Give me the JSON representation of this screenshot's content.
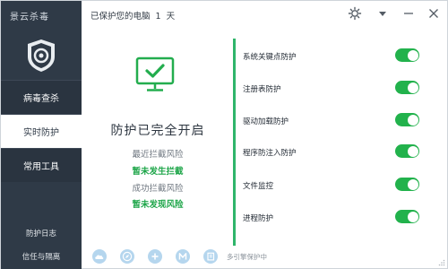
{
  "app": {
    "title": "景云杀毒"
  },
  "header": {
    "protected_text": "已保护您的电脑",
    "days": "1",
    "days_unit": "天"
  },
  "sidebar": {
    "items": [
      {
        "label": "病毒查杀"
      },
      {
        "label": "实时防护"
      },
      {
        "label": "常用工具"
      }
    ],
    "bottom": [
      {
        "label": "防护日志"
      },
      {
        "label": "信任与隔离"
      }
    ]
  },
  "status": {
    "title": "防护已完全开启",
    "recent_label": "最近拦截风险",
    "recent_value": "暂未发生拦截",
    "success_label": "成功拦截风险",
    "success_value": "暂未发现风险"
  },
  "protections": [
    {
      "label": "系统关键点防护",
      "on": true
    },
    {
      "label": "注册表防护",
      "on": true
    },
    {
      "label": "驱动加载防护",
      "on": true
    },
    {
      "label": "程序防注入防护",
      "on": true
    },
    {
      "label": "文件监控",
      "on": true
    },
    {
      "label": "进程防护",
      "on": true
    }
  ],
  "footer": {
    "engine_icons": [
      "cloud-engine-icon",
      "compass-engine-icon",
      "plus-engine-icon",
      "m-engine-icon",
      "book-engine-icon"
    ],
    "engine_status": "多引擎保护中"
  },
  "colors": {
    "sidebar": "#2f3a47",
    "accent_green": "#22b24c",
    "divider": "#2fb56a"
  }
}
